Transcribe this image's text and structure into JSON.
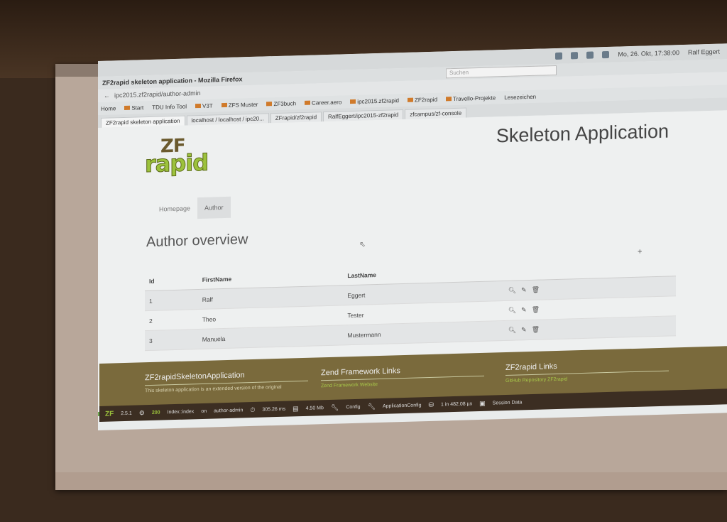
{
  "firefox": {
    "window_title": "ZF2rapid skeleton application - Mozilla Firefox",
    "search_placeholder": "Suchen",
    "url": "ipc2015.zf2rapid/author-admin",
    "bookmarks": [
      "Home",
      "Start",
      "TDU Info Tool",
      "V3T",
      "ZFS Muster",
      "ZF3buch",
      "Career.aero",
      "ipc2015.zf2rapid",
      "ZF2rapid",
      "Travello-Projekte",
      "Lesezeichen"
    ],
    "tabs": [
      "ZF2rapid skeleton application",
      "localhost / localhost / ipc20...",
      "ZFrapid/zf2rapid",
      "RalfEggert/ipc2015-zf2rapid",
      "zfcampus/zf-console"
    ],
    "os_clock": "Mo, 26. Okt, 17:38:00",
    "os_user": "Ralf Eggert"
  },
  "app": {
    "logo_top": "ZF",
    "logo_bottom": "rapid",
    "title": "Skeleton Application",
    "nav": [
      "Homepage",
      "Author"
    ],
    "heading": "Author overview",
    "add_icon": "+",
    "columns": {
      "id": "Id",
      "first": "FirstName",
      "last": "LastName"
    },
    "rows": [
      {
        "id": "1",
        "first": "Ralf",
        "last": "Eggert"
      },
      {
        "id": "2",
        "first": "Theo",
        "last": "Tester"
      },
      {
        "id": "3",
        "first": "Manuela",
        "last": "Mustermann"
      }
    ]
  },
  "footer": {
    "col1_title": "ZF2rapidSkeletonApplication",
    "col1_text": "This skeleton application is an extended version of the original",
    "col2_title": "Zend Framework Links",
    "col2_link": "Zend Framework Website",
    "col3_title": "ZF2rapid Links",
    "col3_link": "GitHub Repository ZF2rapid"
  },
  "toolbar": {
    "zf_version": "2.5.1",
    "status": "200",
    "route": "Index::index",
    "route_on": "on",
    "route_name": "author-admin",
    "time": "305.26 ms",
    "memory": "4.50 Mb",
    "config": "Config",
    "app_config": "ApplicationConfig",
    "db": "1 in 482.08 µs",
    "session": "Session Data"
  },
  "colors": {
    "accent_green": "#9cc23c",
    "footer_bg": "#7a6a3c"
  }
}
